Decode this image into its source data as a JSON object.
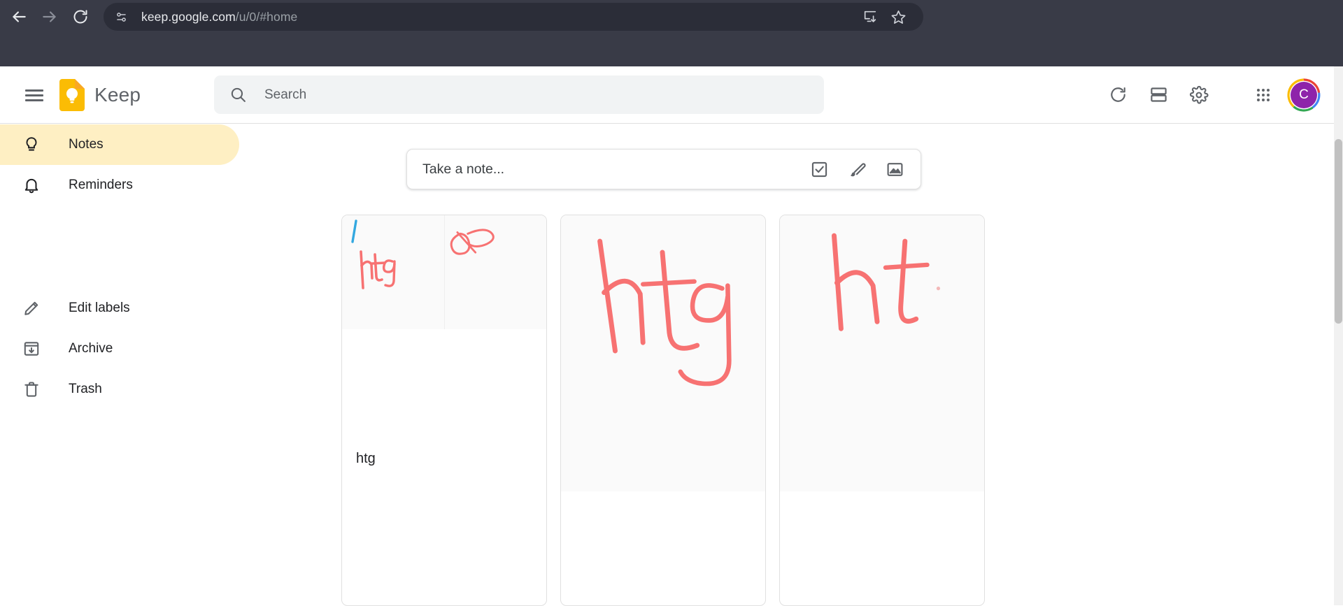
{
  "browser": {
    "back_icon": "back-arrow-icon",
    "forward_icon": "forward-arrow-icon",
    "reload_icon": "reload-icon",
    "site_info_icon": "site-settings-icon",
    "url_host": "keep.google.com",
    "url_path": "/u/0/#home",
    "install_icon": "install-app-icon",
    "bookmark_icon": "bookmark-star-icon",
    "chrome_bg": "#393b47",
    "omnibox_bg": "#2b2d38"
  },
  "header": {
    "menu_icon": "hamburger-menu-icon",
    "logo_icon": "keep-logo-icon",
    "app_title": "Keep",
    "logo_color": "#fbbc04",
    "search": {
      "icon": "search-icon",
      "placeholder": "Search",
      "value": ""
    },
    "actions": [
      {
        "name": "refresh-button",
        "icon": "refresh-icon"
      },
      {
        "name": "list-view-button",
        "icon": "list-view-icon"
      },
      {
        "name": "settings-button",
        "icon": "gear-icon"
      },
      {
        "name": "apps-grid-button",
        "icon": "apps-grid-icon"
      }
    ],
    "account": {
      "initial": "C",
      "bg_color": "#8e24aa",
      "ring_colors": [
        "#ea4335",
        "#4285f4",
        "#34a853",
        "#fbbc04"
      ]
    }
  },
  "sidebar": {
    "active_bg": "#feefc3",
    "items": [
      {
        "label": "Notes",
        "icon": "lightbulb-icon",
        "active": true
      },
      {
        "label": "Reminders",
        "icon": "bell-icon",
        "active": false
      },
      {
        "label": "Edit labels",
        "icon": "pencil-icon",
        "active": false
      },
      {
        "label": "Archive",
        "icon": "archive-icon",
        "active": false
      },
      {
        "label": "Trash",
        "icon": "trash-icon",
        "active": false
      }
    ]
  },
  "composer": {
    "placeholder": "Take a note...",
    "actions": [
      {
        "name": "new-list-button",
        "icon": "checkbox-icon"
      },
      {
        "name": "new-drawing-button",
        "icon": "brush-icon"
      },
      {
        "name": "new-image-button",
        "icon": "image-icon"
      }
    ]
  },
  "notes": [
    {
      "id": "note-1",
      "type": "drawing-with-text",
      "text": "htg",
      "drawings": [
        {
          "name": "drawing-htg-blue-red",
          "strokes": [
            "blue-slash",
            "red-htg"
          ]
        },
        {
          "name": "drawing-red-scribble",
          "strokes": [
            "red-loop-scribble"
          ]
        }
      ],
      "ink_colors": {
        "red": "#f77272",
        "blue": "#33a8e0"
      }
    },
    {
      "id": "note-2",
      "type": "drawing",
      "text": "",
      "drawings": [
        {
          "name": "drawing-htg-large",
          "strokes": [
            "red-htg-large"
          ]
        }
      ],
      "ink_colors": {
        "red": "#f77272"
      }
    },
    {
      "id": "note-3",
      "type": "drawing",
      "text": "",
      "drawings": [
        {
          "name": "drawing-ht-large",
          "strokes": [
            "red-ht-large",
            "red-dot"
          ]
        }
      ],
      "ink_colors": {
        "red": "#f77272"
      }
    }
  ],
  "scrollbar": {
    "name": "page-scrollbar"
  }
}
